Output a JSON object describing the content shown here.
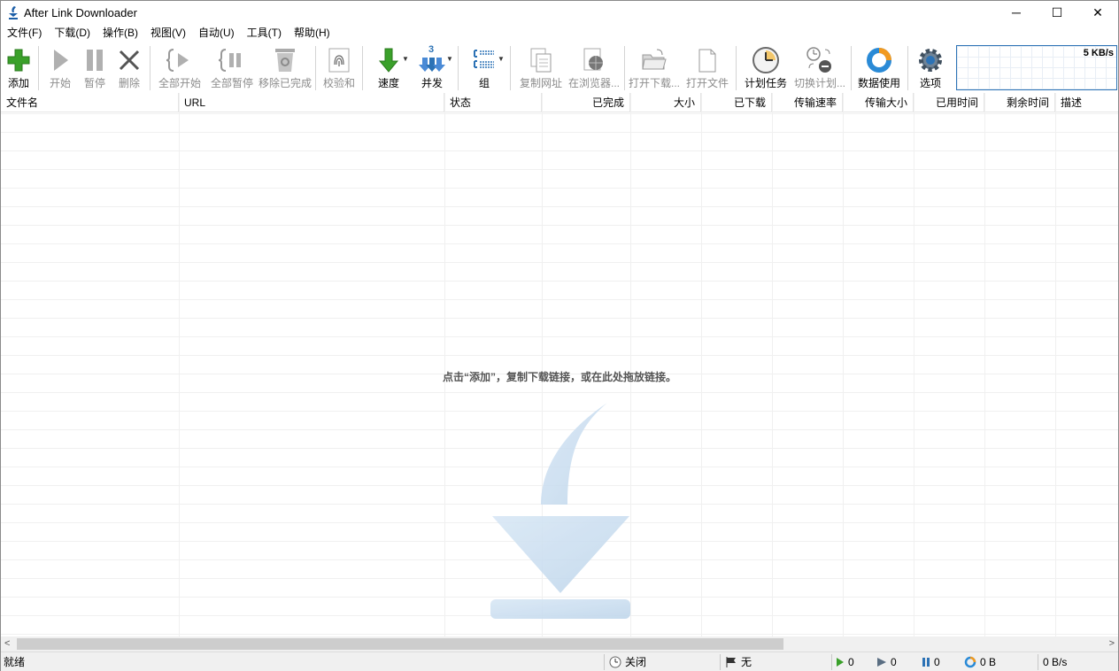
{
  "window": {
    "title": "After Link Downloader",
    "minimize": "─",
    "maximize": "☐",
    "close": "✕"
  },
  "menu": [
    "文件(F)",
    "下载(D)",
    "操作(B)",
    "视图(V)",
    "自动(U)",
    "工具(T)",
    "帮助(H)"
  ],
  "toolbar": {
    "add": "添加",
    "start": "开始",
    "pause": "暂停",
    "delete": "删除",
    "start_all": "全部开始",
    "pause_all": "全部暂停",
    "remove_completed": "移除已完成",
    "checksum": "校验和",
    "speed": "速度",
    "concurrency": "并发",
    "group": "组",
    "copy_url": "复制网址",
    "in_browser": "在浏览器...",
    "open_folder": "打开下载...",
    "open_file": "打开文件",
    "scheduler": "计划任务",
    "switch_schedule": "切换计划...",
    "data_usage": "数据使用",
    "options": "选项",
    "concurrency_badge": "3"
  },
  "speed_graph": {
    "value": "5 KB/s"
  },
  "columns": [
    "文件名",
    "URL",
    "状态",
    "已完成",
    "大小",
    "已下载",
    "传输速率",
    "传输大小",
    "已用时间",
    "剩余时间",
    "描述"
  ],
  "empty_hint": "点击“添加”，复制下载链接，或在此处拖放链接。",
  "status": {
    "left": "就绪",
    "schedule": "关闭",
    "limit": "无",
    "running": "0",
    "queued": "0",
    "paused": "0",
    "data": "0 B",
    "speed": "0 B/s"
  },
  "colors": {
    "accent": "#2c72b5",
    "green": "#3aa02a"
  }
}
